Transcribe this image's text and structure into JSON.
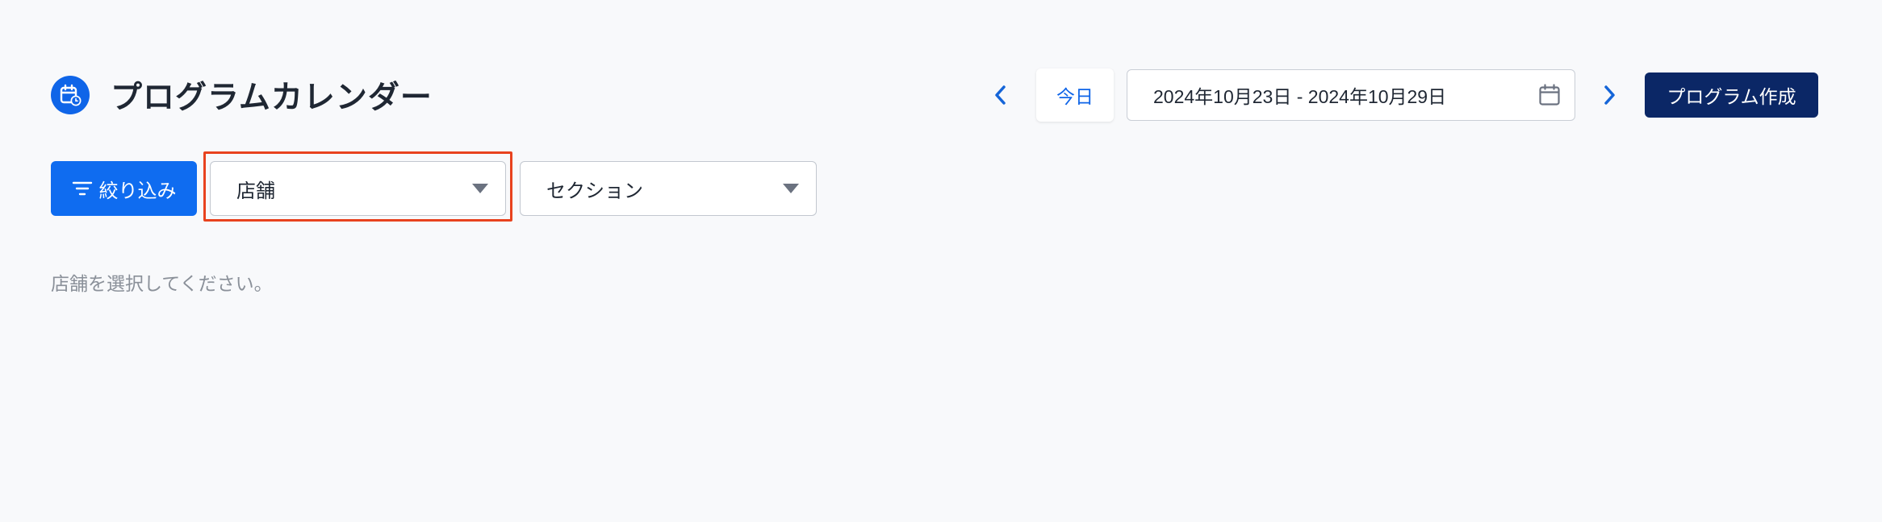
{
  "header": {
    "title": "プログラムカレンダー",
    "title_icon": "calendar-clock-icon",
    "today_label": "今日",
    "date_range": "2024年10月23日 - 2024年10月29日",
    "create_label": "プログラム作成"
  },
  "filters": {
    "filter_label": "絞り込み",
    "store_select": {
      "value": "店舗"
    },
    "section_select": {
      "value": "セクション"
    }
  },
  "main": {
    "helper_text": "店舗を選択してください。"
  },
  "colors": {
    "primary": "#0f6cf0",
    "navy": "#0b2766",
    "highlight": "#e8421e",
    "background": "#f8f9fb"
  }
}
